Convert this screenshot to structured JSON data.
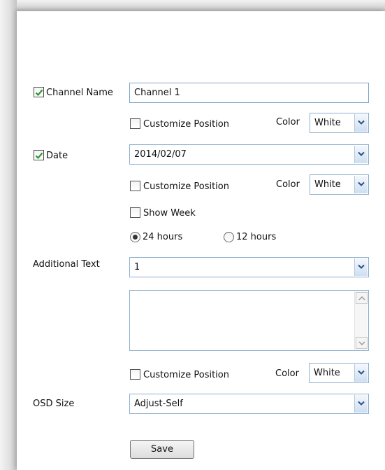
{
  "channel_name": {
    "label": "Channel Name",
    "checked": true,
    "value": "Channel 1",
    "customize_position_label": "Customize Position",
    "color_label": "Color",
    "color_value": "White"
  },
  "date": {
    "label": "Date",
    "checked": true,
    "format_value": "2014/02/07",
    "customize_position_label": "Customize Position",
    "color_label": "Color",
    "color_value": "White",
    "show_week_label": "Show Week",
    "hour24_label": "24 hours",
    "hour12_label": "12 hours",
    "hour24_selected": true
  },
  "additional_text": {
    "label": "Additional Text",
    "select_value": "1",
    "text_value": "",
    "customize_position_label": "Customize Position",
    "color_label": "Color",
    "color_value": "White"
  },
  "osd_size": {
    "label": "OSD Size",
    "value": "Adjust-Self"
  },
  "save_label": "Save",
  "colors": {
    "checkmark": "#2a9a2a",
    "field_border": "#7fa7c8",
    "dropdown_arrow": "#2a4f8a"
  }
}
